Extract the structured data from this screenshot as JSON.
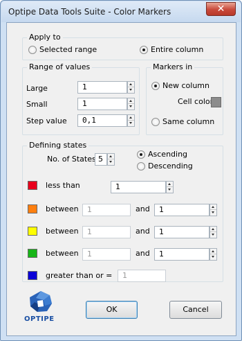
{
  "window": {
    "title": "Optipe Data Tools Suite - Color Markers",
    "close_glyph": "✕"
  },
  "apply_to": {
    "legend": "Apply to",
    "options": [
      "Selected range",
      "Entire column"
    ],
    "selected": "Entire column"
  },
  "range": {
    "legend": "Range of values",
    "large_label": "Large",
    "large_value": "1",
    "small_label": "Small",
    "small_value": "1",
    "step_label": "Step value",
    "step_value": "0,1"
  },
  "markers_in": {
    "legend": "Markers in",
    "new_column": "New column",
    "cell_color_label": "Cell color",
    "cell_color": "#8c8c8c",
    "same_column": "Same column",
    "selected": "New column"
  },
  "states": {
    "legend": "Defining states",
    "num_label": "No. of States",
    "num_value": "5",
    "ascending": "Ascending",
    "descending": "Descending",
    "order": "Ascending",
    "rows": [
      {
        "color": "#e8001c",
        "op": "less than",
        "value": "1"
      },
      {
        "color": "#ff7f0f",
        "op": "between",
        "from": "1",
        "and": "and",
        "to": "1"
      },
      {
        "color": "#ffff00",
        "op": "between",
        "from": "1",
        "and": "and",
        "to": "1"
      },
      {
        "color": "#17b517",
        "op": "between",
        "from": "1",
        "and": "and",
        "to": "1"
      },
      {
        "color": "#0b00d6",
        "op": "greater than or =",
        "value": "1"
      }
    ]
  },
  "footer": {
    "logo_text": "OPTIPE",
    "ok_label": "OK",
    "cancel_label": "Cancel"
  }
}
